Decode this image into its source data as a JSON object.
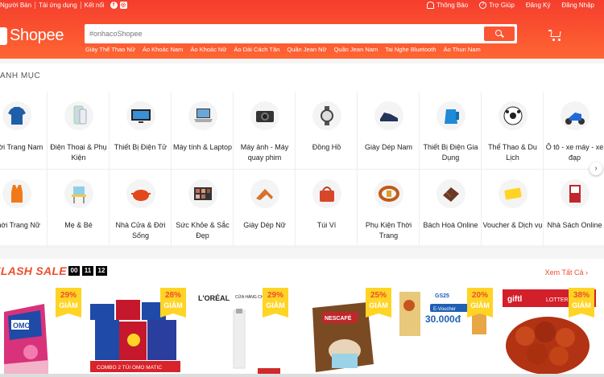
{
  "topbar": {
    "left": [
      "Người Bán",
      "Tải ứng dụng",
      "Kết nối"
    ],
    "right": [
      "Thông Báo",
      "Trợ Giúp",
      "Đăng Ký",
      "Đăng Nhập"
    ]
  },
  "header": {
    "logo": "Shopee",
    "search_placeholder": "#onhacoShopee",
    "hints": [
      "Giày Thể Thao Nữ",
      "Áo Khoác Nam",
      "Áo Khoác Nữ",
      "Áo Dài Cách Tân",
      "Quần Jean Nữ",
      "Quần Jean Nam",
      "Tai Nghe Bluetooth",
      "Áo Thun Nam"
    ]
  },
  "category": {
    "title": "ANH MỤC",
    "items": [
      {
        "label": "Thời Trang Nam",
        "icon": "shirt-icon"
      },
      {
        "label": "Điện Thoại & Phụ Kiện",
        "icon": "phone-icon"
      },
      {
        "label": "Thiết Bị Điện Tử",
        "icon": "tv-icon"
      },
      {
        "label": "Máy tính & Laptop",
        "icon": "laptop-icon"
      },
      {
        "label": "Máy ảnh - Máy quay phim",
        "icon": "camera-icon"
      },
      {
        "label": "Đồng Hồ",
        "icon": "watch-icon"
      },
      {
        "label": "Giày Dép Nam",
        "icon": "shoe-icon"
      },
      {
        "label": "Thiết Bị Điện Gia Dụng",
        "icon": "kettle-icon"
      },
      {
        "label": "Thể Thao & Du Lịch",
        "icon": "ball-icon"
      },
      {
        "label": "Ô tô - xe máy - xe đạp",
        "icon": "scooter-icon"
      },
      {
        "label": "Thời Trang Nữ",
        "icon": "tanktop-icon"
      },
      {
        "label": "Mẹ & Bé",
        "icon": "highchair-icon"
      },
      {
        "label": "Nhà Cửa & Đời Sống",
        "icon": "pot-icon"
      },
      {
        "label": "Sức Khỏe & Sắc Đẹp",
        "icon": "palette-icon"
      },
      {
        "label": "Giày Dép Nữ",
        "icon": "heel-icon"
      },
      {
        "label": "Túi Ví",
        "icon": "bag-icon"
      },
      {
        "label": "Phụ Kiện Thời Trang",
        "icon": "belt-icon"
      },
      {
        "label": "Bách Hoá Online",
        "icon": "chocolate-icon"
      },
      {
        "label": "Voucher & Dịch vụ",
        "icon": "voucher-icon"
      },
      {
        "label": "Nhà Sách Online",
        "icon": "book-icon"
      }
    ]
  },
  "flash_sale": {
    "title": "FLASH SALE",
    "timer": [
      "00",
      "11",
      "12"
    ],
    "see_all": "Xem Tất Cả",
    "products": [
      {
        "pct": "29%",
        "giam": "GIẢM"
      },
      {
        "pct": "28%",
        "giam": "GIẢM"
      },
      {
        "pct": "29%",
        "giam": "GIẢM"
      },
      {
        "pct": "25%",
        "giam": "GIẢM"
      },
      {
        "pct": "20%",
        "giam": "GIẢM"
      },
      {
        "pct": "38%",
        "giam": "GIẢM"
      }
    ],
    "product_texts": {
      "combo": "COMBO 2 TÚI OMO MATIC",
      "loreal": "L'ORÉAL",
      "chinh_hang": "CỬA HÀNG CHÍNH HÃNG",
      "nescafe": "NESCAFÉ",
      "gs25": "GS25",
      "evoucher": "E-Voucher",
      "voucher_amount": "30.000đ",
      "giftpop": "giftl",
      "lotteria": "LOTTERIA"
    }
  }
}
